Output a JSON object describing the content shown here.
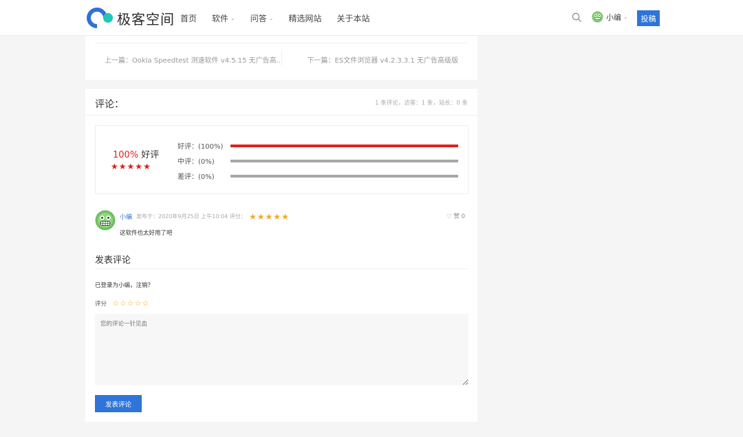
{
  "header": {
    "logo_text": "极客空间",
    "nav": [
      {
        "label": "首页",
        "caret": false
      },
      {
        "label": "软件",
        "caret": true
      },
      {
        "label": "问答",
        "caret": true
      },
      {
        "label": "精选网站",
        "caret": false
      },
      {
        "label": "关于本站",
        "caret": false
      }
    ],
    "user_name": "小编",
    "submit_label": "投稿",
    "icons": {
      "search": "search-icon",
      "user_caret": "chevron-down-icon"
    },
    "colors": {
      "brand_blue": "#2f6fde",
      "brand_teal": "#1fc9b6",
      "button_blue": "#2f74d8"
    }
  },
  "prev_next": {
    "prev": "上一篇：Ookla Speedtest 测速软件 v4.5.15 无广告高...",
    "next": "下一篇：ES文件浏览器 v4.2.3.3.1 无广告高级版"
  },
  "comments": {
    "title": "评论：",
    "stats": "1 条评论，访客：1 条，站长：0 条",
    "summary": {
      "percent": "100%",
      "label": " 好评",
      "stars": 5,
      "bars": [
        {
          "label": "好评：(100%)",
          "fraction": 1.0,
          "color": "#e0201b"
        },
        {
          "label": "中评：(0%)",
          "fraction": 0.0,
          "color": "#e0201b"
        },
        {
          "label": "差评：(0%)",
          "fraction": 0.0,
          "color": "#e0201b"
        }
      ]
    },
    "items": [
      {
        "author": "小编",
        "meta": "发布于：2020年9月25日 上午10:04   评分：",
        "rating": 5,
        "likes": "赞 0",
        "text": "这软件也太好用了吧"
      }
    ]
  },
  "post": {
    "title": "发表评论",
    "logged_in": "已登录为小编，注销？",
    "rate_label": "评分",
    "rate_stars": 5,
    "placeholder": "您的评论一针见血",
    "submit_label": "发表评论"
  }
}
